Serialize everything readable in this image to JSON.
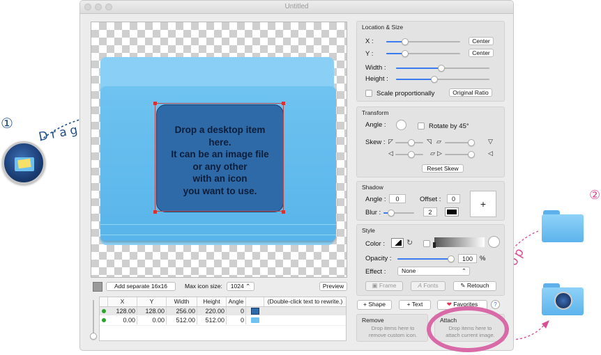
{
  "window": {
    "title": "Untitled"
  },
  "canvas": {
    "drop_text": [
      "Drop a desktop item",
      "here.",
      "It can be an image file",
      "or any other",
      "with an icon",
      "you want to use."
    ]
  },
  "bottom_bar": {
    "add_label": "Add separate 16x16",
    "max_label": "Max icon size:",
    "max_value": "1024",
    "preview_label": "Preview"
  },
  "table": {
    "headers": [
      "X",
      "Y",
      "Width",
      "Height",
      "Angle",
      "",
      "(Double-click text to rewrite.)"
    ],
    "rows": [
      {
        "x": "128.00",
        "y": "128.00",
        "width": "256.00",
        "height": "220.00",
        "angle": "0"
      },
      {
        "x": "0.00",
        "y": "0.00",
        "width": "512.00",
        "height": "512.00",
        "angle": "0"
      }
    ]
  },
  "location_size": {
    "title": "Location & Size",
    "x_label": "X :",
    "y_label": "Y :",
    "center_label": "Center",
    "width_label": "Width :",
    "height_label": "Height :",
    "scale_label": "Scale proportionally",
    "original_ratio_label": "Original Ratio",
    "x_level": 0.2,
    "y_level": 0.2,
    "width_level": 0.5,
    "height_level": 0.5
  },
  "transform": {
    "title": "Transform",
    "angle_label": "Angle :",
    "rotate_label": "Rotate by 45°",
    "skew_label": "Skew :",
    "reset_label": "Reset Skew"
  },
  "shadow": {
    "title": "Shadow",
    "angle_label": "Angle :",
    "angle_value": "0",
    "offset_label": "Offset :",
    "offset_value": "0",
    "blur_label": "Blur :",
    "blur_value": "2",
    "plus": "+"
  },
  "style": {
    "title": "Style",
    "color_label": "Color :",
    "opacity_label": "Opacity :",
    "opacity_value": "100",
    "percent": "%",
    "effect_label": "Effect :",
    "effect_value": "None",
    "frame_label": "Frame",
    "fonts_label": "Fonts",
    "retouch_label": "Retouch"
  },
  "actions": {
    "shape_label": "+ Shape",
    "text_label": "+ Text",
    "favorites_label": "Favorites",
    "help": "?"
  },
  "remove": {
    "title": "Remove",
    "text": [
      "Drop items here to",
      "remove custom icon."
    ]
  },
  "attach": {
    "title": "Attach",
    "text": [
      "Drop items here to",
      "attach current image."
    ]
  },
  "annotations": {
    "step1": "①",
    "step2": "②",
    "drag_drop": "Drag & Drop",
    "drop": "Drop"
  },
  "colors": {
    "accent": "#3a7bf0",
    "annotation_blue": "#1f4e8c",
    "annotation_pink": "#d94f95",
    "folder_blue": "#7cc6f2",
    "drop_box": "#2f6aa8",
    "highlight_ring": "#d86aa8"
  }
}
